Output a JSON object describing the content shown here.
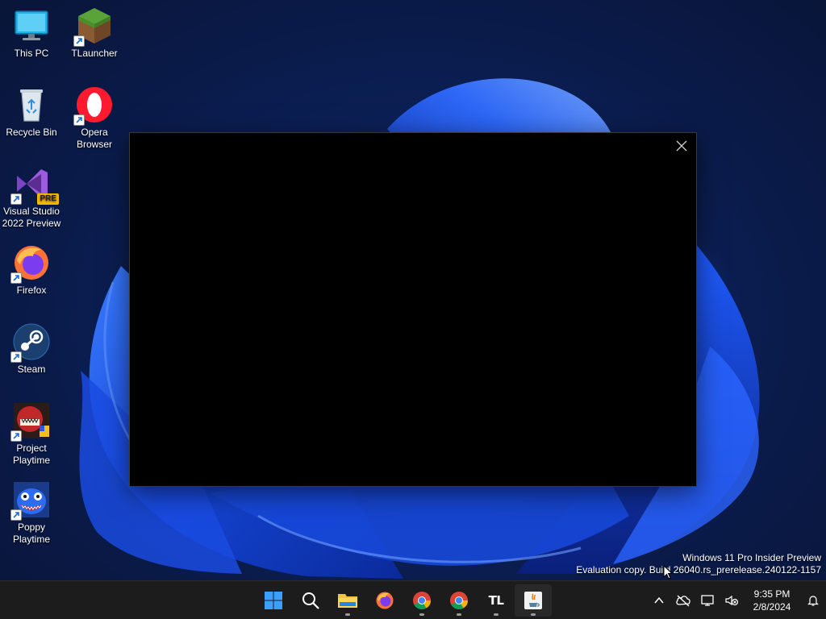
{
  "desktop": {
    "icons": [
      {
        "label": "This PC",
        "icon": "monitor-icon"
      },
      {
        "label": "TLauncher",
        "icon": "minecraft-grass-block-icon"
      },
      {
        "label": "Recycle Bin",
        "icon": "recycle-bin-icon"
      },
      {
        "label": "Opera Browser",
        "icon": "opera-icon"
      },
      {
        "label": "Visual Studio 2022 Preview",
        "icon": "visual-studio-preview-icon",
        "badge": "PRE"
      },
      {
        "label": "Firefox",
        "icon": "firefox-icon"
      },
      {
        "label": "Steam",
        "icon": "steam-icon"
      },
      {
        "label": "Project Playtime",
        "icon": "project-playtime-icon"
      },
      {
        "label": "Poppy Playtime",
        "icon": "poppy-playtime-icon"
      }
    ]
  },
  "popup": {
    "close_icon": "close-icon"
  },
  "watermark": {
    "line1": "Windows 11 Pro Insider Preview",
    "line2": "Evaluation copy. Build 26040.rs_prerelease.240122-1157"
  },
  "taskbar": {
    "apps": [
      {
        "name": "Start",
        "icon": "windows-start-icon"
      },
      {
        "name": "Search",
        "icon": "search-icon"
      },
      {
        "name": "File Explorer",
        "icon": "folder-icon"
      },
      {
        "name": "Firefox",
        "icon": "firefox-icon"
      },
      {
        "name": "Google Chrome",
        "icon": "chrome-icon"
      },
      {
        "name": "Google Chrome",
        "icon": "chrome-icon"
      },
      {
        "name": "TLauncher",
        "icon": "tlauncher-icon",
        "text": "TL"
      },
      {
        "name": "Java",
        "icon": "java-icon"
      }
    ],
    "tray": {
      "clock_time": "9:35 PM",
      "clock_date": "2/8/2024"
    }
  },
  "colors": {
    "accent": "#0078d4",
    "taskbar_bg": "#1c1c1c",
    "popup_bg": "#000000"
  }
}
